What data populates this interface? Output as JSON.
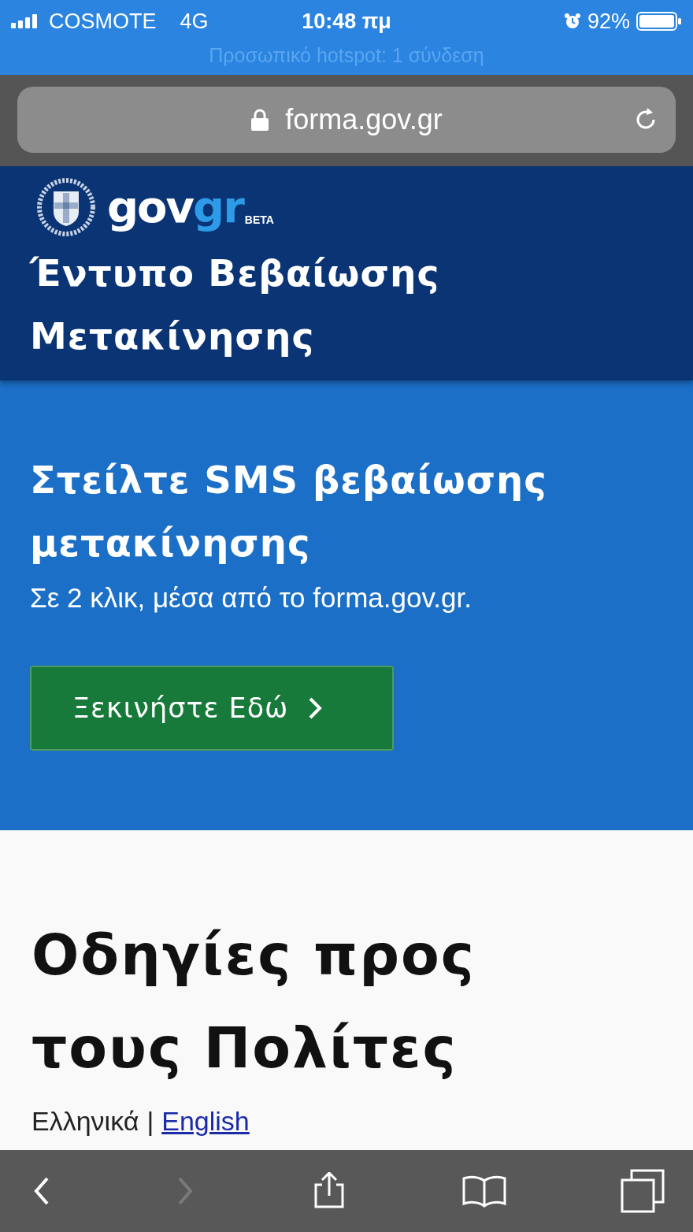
{
  "status_bar": {
    "carrier": "COSMOTE",
    "network": "4G",
    "time": "10:48 πμ",
    "battery": "92%",
    "hotspot": "Προσωπικό hotspot: 1 σύνδεση"
  },
  "address_bar": {
    "url": "forma.gov.gr",
    "secure": true
  },
  "header": {
    "logo": {
      "part_1": "gov",
      "part_2": "gr",
      "tag": "BETA"
    },
    "title": "Έντυπο Βεβαίωσης Μετακίνησης"
  },
  "hero": {
    "title": "Στείλτε SMS βεβαίωσης μετακίνησης",
    "subtitle": "Σε 2 κλικ, μέσα από το forma.gov.gr.",
    "button": "Ξεκινήστε Εδώ"
  },
  "content": {
    "heading": "Οδηγίες προς τους Πολίτες",
    "separator": "|",
    "languages": [
      {
        "label": "Ελληνικά",
        "selected": true
      },
      {
        "label": "English",
        "selected": false
      }
    ]
  },
  "toolbar": [
    {
      "kind": "back",
      "disabled": false
    },
    {
      "kind": "forward",
      "disabled": true
    },
    {
      "kind": "share",
      "disabled": false
    },
    {
      "kind": "bookmarks",
      "disabled": false
    },
    {
      "kind": "tabs",
      "disabled": false
    }
  ]
}
